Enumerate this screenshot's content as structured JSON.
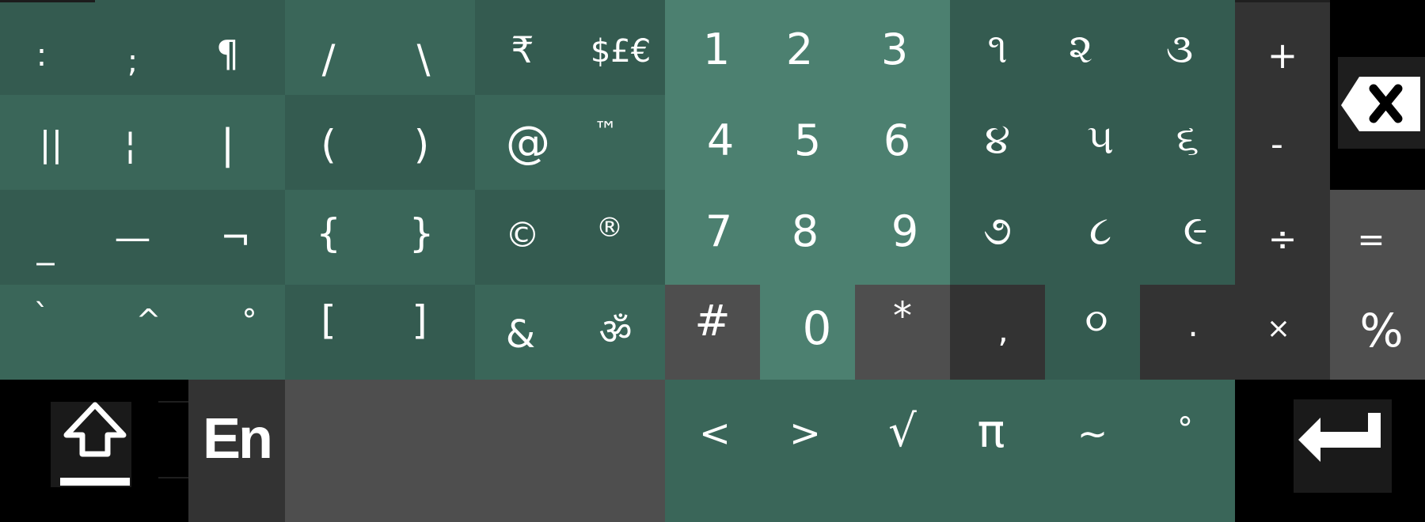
{
  "colors": {
    "green_dark": "#345b50",
    "green_mid": "#3a6659",
    "green_light": "#4c8070",
    "grey_mid": "#4e4e4e",
    "grey_dark": "#333333",
    "black": "#000000",
    "text": "#ffffff"
  },
  "punct": {
    "row1": [
      ":",
      ";",
      "¶"
    ],
    "row2": [
      "||",
      "¦",
      "|"
    ],
    "row3": [
      "_",
      "—",
      "¬"
    ],
    "row4": [
      "`",
      "^",
      "°"
    ]
  },
  "brackets": {
    "row1": [
      "/",
      "\\"
    ],
    "row2": [
      "(",
      ")"
    ],
    "row3": [
      "{",
      "}"
    ],
    "row4": [
      "[",
      "]"
    ]
  },
  "symbols": {
    "row1": [
      "₹",
      "$£€"
    ],
    "row2": [
      "@",
      "™"
    ],
    "row3": [
      "©",
      "®"
    ],
    "row4": [
      "&",
      "ॐ"
    ]
  },
  "numpad": {
    "digits": [
      "1",
      "2",
      "3",
      "4",
      "5",
      "6",
      "7",
      "8",
      "9"
    ],
    "hash": "#",
    "zero": "0",
    "star": "*"
  },
  "native_digits": {
    "digits": [
      "૧",
      "૨",
      "૩",
      "૪",
      "૫",
      "૬",
      "૭",
      "૮",
      "૯"
    ],
    "comma": ",",
    "zero": "૦",
    "period": "."
  },
  "operators": {
    "plus": "+",
    "minus": "-",
    "divide": "÷",
    "times": "×",
    "equals": "=",
    "percent": "%"
  },
  "bottom": {
    "language": "En",
    "math": [
      "<",
      ">",
      "√",
      "π",
      "~",
      "°"
    ]
  },
  "icons": {
    "shift": "shift-arrow-up-icon",
    "backspace": "backspace-icon",
    "enter": "enter-return-icon"
  }
}
